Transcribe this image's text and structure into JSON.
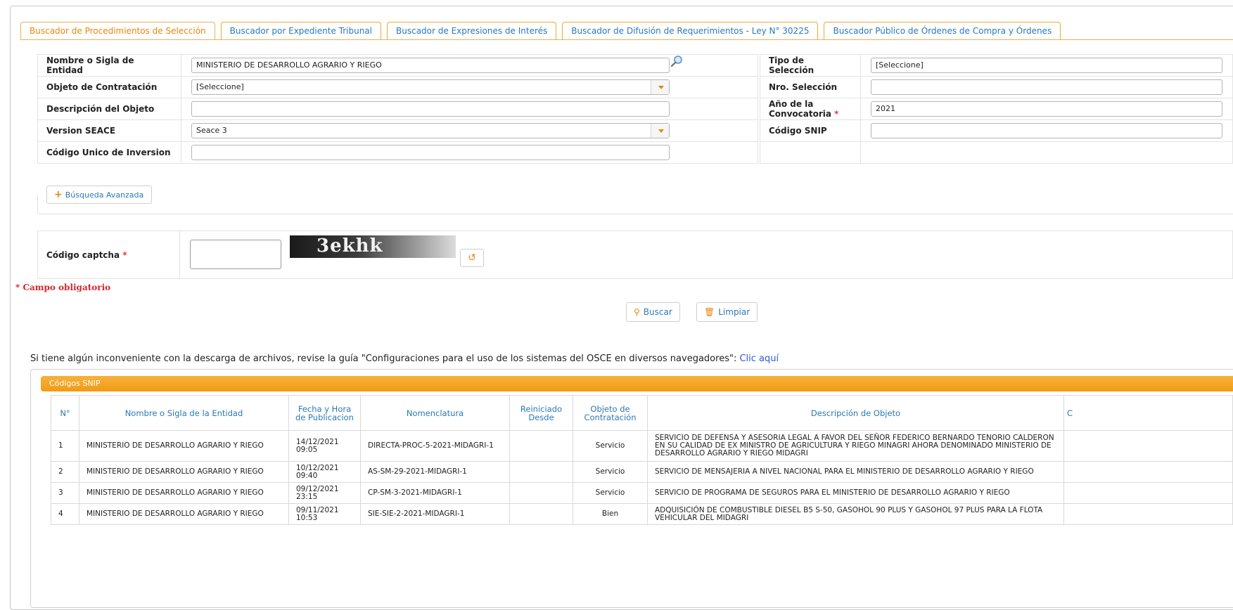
{
  "tabs": [
    {
      "label": "Buscador de Procedimientos de Selección",
      "active": true
    },
    {
      "label": "Buscador por Expediente Tribunal",
      "active": false
    },
    {
      "label": "Buscador de Expresiones de Interés",
      "active": false
    },
    {
      "label": "Buscador de Difusión de Requerimientos - Ley N° 30225",
      "active": false
    },
    {
      "label": "Buscador Público de Órdenes de Compra y Órdenes",
      "active": false
    }
  ],
  "form": {
    "entidad_label": "Nombre o Sigla de Entidad",
    "entidad_value": "MINISTERIO DE DESARROLLO AGRARIO Y RIEGO",
    "objeto_label": "Objeto de Contratación",
    "objeto_value": "[Seleccione]",
    "descripcion_label": "Descripción del Objeto",
    "descripcion_value": "",
    "version_label": "Version SEACE",
    "version_value": "Seace 3",
    "cui_label": "Código Unico de Inversion",
    "cui_value": "",
    "tipo_label": "Tipo de Selección",
    "tipo_value": "[Seleccione]",
    "nro_label": "Nro. Selección",
    "nro_value": "",
    "anio_label": "Año de la Convocatoria",
    "anio_value": "2021",
    "snip_label": "Código SNIP",
    "snip_value": ""
  },
  "required_mark": "*",
  "advanced_label": "Búsqueda Avanzada",
  "captcha": {
    "label": "Código captcha",
    "image_text": "3ekhk",
    "value": ""
  },
  "required_note": "* Campo obligatorio",
  "buttons": {
    "search": "Buscar",
    "clear": "Limpiar"
  },
  "info": {
    "text": "Si tiene algún inconveniente con la descarga de archivos, revise la guía \"Configuraciones para el uso de los sistemas del OSCE en diversos navegadores\": ",
    "link": "Clic aquí"
  },
  "results_panel_title": "Códigos SNIP",
  "results": {
    "headers": [
      "N°",
      "Nombre o Sigla de la Entidad",
      "Fecha y Hora de Publicacion",
      "Nomenclatura",
      "Reiniciado Desde",
      "Objeto de Contratación",
      "Descripción de Objeto",
      "C"
    ],
    "rows": [
      {
        "n": "1",
        "entidad": "MINISTERIO DE DESARROLLO AGRARIO Y RIEGO",
        "fecha": "14/12/2021 09:05",
        "nomenclatura": "DIRECTA-PROC-5-2021-MIDAGRI-1",
        "reiniciado": "",
        "objeto": "Servicio",
        "descripcion": "SERVICIO DE DEFENSA Y ASESORIA LEGAL A FAVOR DEL SEÑOR FEDERICO BERNARDO TENORIO CALDERON EN SU CALIDAD DE EX MINISTRO DE AGRICULTURA Y RIEGO MINAGRI AHORA DENOMINADO MINISTERIO DE DESARROLLO AGRARIO Y RIEGO MIDAGRI"
      },
      {
        "n": "2",
        "entidad": "MINISTERIO DE DESARROLLO AGRARIO Y RIEGO",
        "fecha": "10/12/2021 09:40",
        "nomenclatura": "AS-SM-29-2021-MIDAGRI-1",
        "reiniciado": "",
        "objeto": "Servicio",
        "descripcion": "SERVICIO DE MENSAJERIA A NIVEL NACIONAL PARA EL MINISTERIO DE DESARROLLO AGRARIO Y RIEGO"
      },
      {
        "n": "3",
        "entidad": "MINISTERIO DE DESARROLLO AGRARIO Y RIEGO",
        "fecha": "09/12/2021 23:15",
        "nomenclatura": "CP-SM-3-2021-MIDAGRI-1",
        "reiniciado": "",
        "objeto": "Servicio",
        "descripcion": "SERVICIO DE PROGRAMA DE SEGUROS PARA EL MINISTERIO DE DESARROLLO AGRARIO Y RIEGO"
      },
      {
        "n": "4",
        "entidad": "MINISTERIO DE DESARROLLO AGRARIO Y RIEGO",
        "fecha": "09/11/2021 10:53",
        "nomenclatura": "SIE-SIE-2-2021-MIDAGRI-1",
        "reiniciado": "",
        "objeto": "Bien",
        "descripcion": "ADQUISICIÓN DE COMBUSTIBLE DIESEL B5 S-50, GASOHOL 90 PLUS Y GASOHOL 97 PLUS PARA LA FLOTA VEHICULAR DEL MIDAGRI"
      }
    ]
  },
  "colors": {
    "accent": "#e8870c",
    "link": "#2a79b5",
    "required": "#d9262b",
    "panel_header": "#f29a14"
  }
}
